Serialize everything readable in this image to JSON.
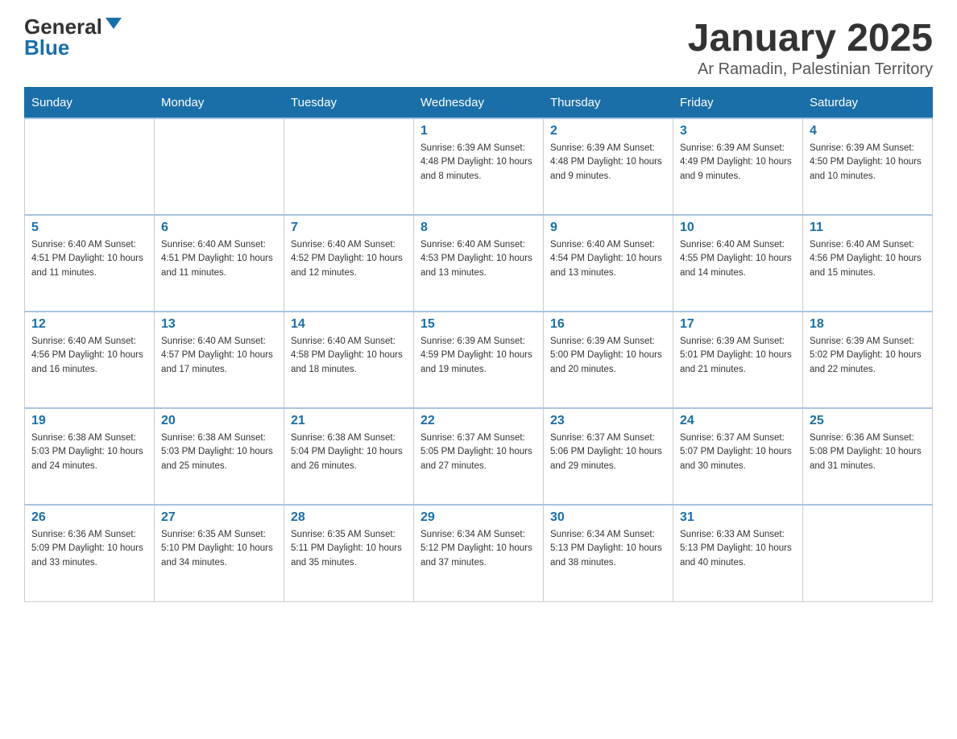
{
  "header": {
    "logo": {
      "general": "General",
      "blue": "Blue",
      "triangle": "▶"
    },
    "title": "January 2025",
    "location": "Ar Ramadin, Palestinian Territory"
  },
  "weekdays": [
    "Sunday",
    "Monday",
    "Tuesday",
    "Wednesday",
    "Thursday",
    "Friday",
    "Saturday"
  ],
  "weeks": [
    [
      {
        "day": "",
        "info": ""
      },
      {
        "day": "",
        "info": ""
      },
      {
        "day": "",
        "info": ""
      },
      {
        "day": "1",
        "info": "Sunrise: 6:39 AM\nSunset: 4:48 PM\nDaylight: 10 hours and 8 minutes."
      },
      {
        "day": "2",
        "info": "Sunrise: 6:39 AM\nSunset: 4:48 PM\nDaylight: 10 hours and 9 minutes."
      },
      {
        "day": "3",
        "info": "Sunrise: 6:39 AM\nSunset: 4:49 PM\nDaylight: 10 hours and 9 minutes."
      },
      {
        "day": "4",
        "info": "Sunrise: 6:39 AM\nSunset: 4:50 PM\nDaylight: 10 hours and 10 minutes."
      }
    ],
    [
      {
        "day": "5",
        "info": "Sunrise: 6:40 AM\nSunset: 4:51 PM\nDaylight: 10 hours and 11 minutes."
      },
      {
        "day": "6",
        "info": "Sunrise: 6:40 AM\nSunset: 4:51 PM\nDaylight: 10 hours and 11 minutes."
      },
      {
        "day": "7",
        "info": "Sunrise: 6:40 AM\nSunset: 4:52 PM\nDaylight: 10 hours and 12 minutes."
      },
      {
        "day": "8",
        "info": "Sunrise: 6:40 AM\nSunset: 4:53 PM\nDaylight: 10 hours and 13 minutes."
      },
      {
        "day": "9",
        "info": "Sunrise: 6:40 AM\nSunset: 4:54 PM\nDaylight: 10 hours and 13 minutes."
      },
      {
        "day": "10",
        "info": "Sunrise: 6:40 AM\nSunset: 4:55 PM\nDaylight: 10 hours and 14 minutes."
      },
      {
        "day": "11",
        "info": "Sunrise: 6:40 AM\nSunset: 4:56 PM\nDaylight: 10 hours and 15 minutes."
      }
    ],
    [
      {
        "day": "12",
        "info": "Sunrise: 6:40 AM\nSunset: 4:56 PM\nDaylight: 10 hours and 16 minutes."
      },
      {
        "day": "13",
        "info": "Sunrise: 6:40 AM\nSunset: 4:57 PM\nDaylight: 10 hours and 17 minutes."
      },
      {
        "day": "14",
        "info": "Sunrise: 6:40 AM\nSunset: 4:58 PM\nDaylight: 10 hours and 18 minutes."
      },
      {
        "day": "15",
        "info": "Sunrise: 6:39 AM\nSunset: 4:59 PM\nDaylight: 10 hours and 19 minutes."
      },
      {
        "day": "16",
        "info": "Sunrise: 6:39 AM\nSunset: 5:00 PM\nDaylight: 10 hours and 20 minutes."
      },
      {
        "day": "17",
        "info": "Sunrise: 6:39 AM\nSunset: 5:01 PM\nDaylight: 10 hours and 21 minutes."
      },
      {
        "day": "18",
        "info": "Sunrise: 6:39 AM\nSunset: 5:02 PM\nDaylight: 10 hours and 22 minutes."
      }
    ],
    [
      {
        "day": "19",
        "info": "Sunrise: 6:38 AM\nSunset: 5:03 PM\nDaylight: 10 hours and 24 minutes."
      },
      {
        "day": "20",
        "info": "Sunrise: 6:38 AM\nSunset: 5:03 PM\nDaylight: 10 hours and 25 minutes."
      },
      {
        "day": "21",
        "info": "Sunrise: 6:38 AM\nSunset: 5:04 PM\nDaylight: 10 hours and 26 minutes."
      },
      {
        "day": "22",
        "info": "Sunrise: 6:37 AM\nSunset: 5:05 PM\nDaylight: 10 hours and 27 minutes."
      },
      {
        "day": "23",
        "info": "Sunrise: 6:37 AM\nSunset: 5:06 PM\nDaylight: 10 hours and 29 minutes."
      },
      {
        "day": "24",
        "info": "Sunrise: 6:37 AM\nSunset: 5:07 PM\nDaylight: 10 hours and 30 minutes."
      },
      {
        "day": "25",
        "info": "Sunrise: 6:36 AM\nSunset: 5:08 PM\nDaylight: 10 hours and 31 minutes."
      }
    ],
    [
      {
        "day": "26",
        "info": "Sunrise: 6:36 AM\nSunset: 5:09 PM\nDaylight: 10 hours and 33 minutes."
      },
      {
        "day": "27",
        "info": "Sunrise: 6:35 AM\nSunset: 5:10 PM\nDaylight: 10 hours and 34 minutes."
      },
      {
        "day": "28",
        "info": "Sunrise: 6:35 AM\nSunset: 5:11 PM\nDaylight: 10 hours and 35 minutes."
      },
      {
        "day": "29",
        "info": "Sunrise: 6:34 AM\nSunset: 5:12 PM\nDaylight: 10 hours and 37 minutes."
      },
      {
        "day": "30",
        "info": "Sunrise: 6:34 AM\nSunset: 5:13 PM\nDaylight: 10 hours and 38 minutes."
      },
      {
        "day": "31",
        "info": "Sunrise: 6:33 AM\nSunset: 5:13 PM\nDaylight: 10 hours and 40 minutes."
      },
      {
        "day": "",
        "info": ""
      }
    ]
  ]
}
